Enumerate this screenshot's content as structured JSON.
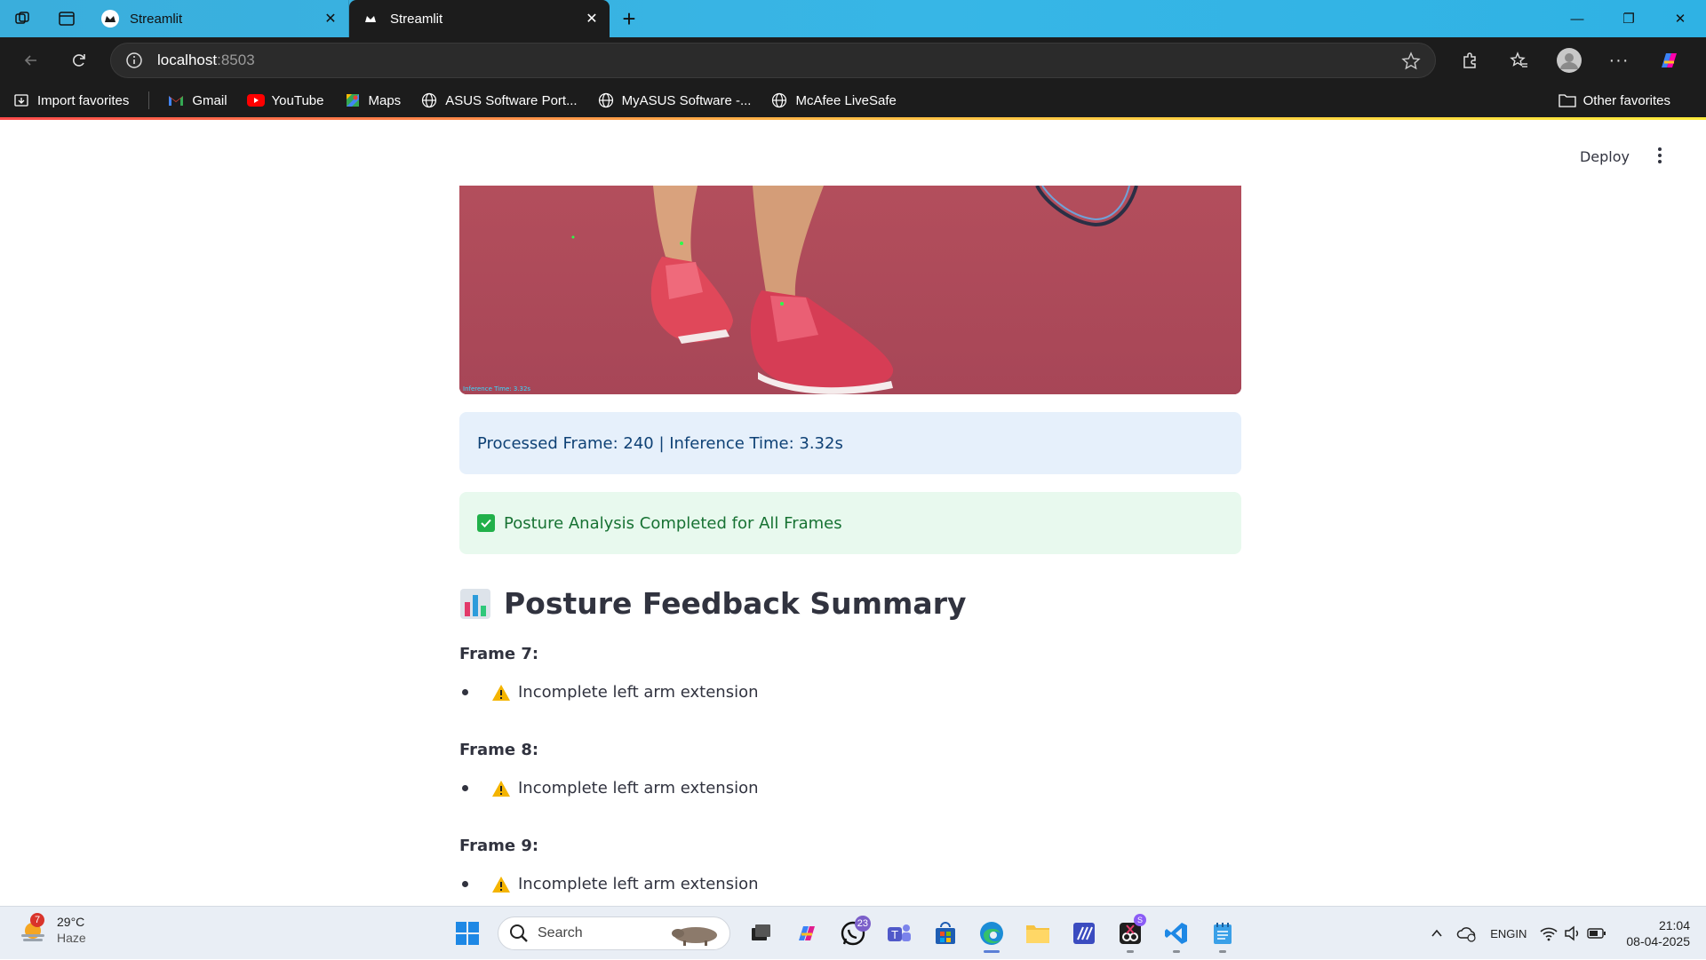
{
  "browser": {
    "tabs": [
      {
        "title": "Streamlit",
        "active": false
      },
      {
        "title": "Streamlit",
        "active": true
      }
    ],
    "address": {
      "host": "localhost",
      "port": ":8503"
    },
    "bookmarks": [
      {
        "label": "Import favorites",
        "icon": "import-icon"
      },
      {
        "label": "Gmail",
        "icon": "gmail-icon"
      },
      {
        "label": "YouTube",
        "icon": "youtube-icon"
      },
      {
        "label": "Maps",
        "icon": "maps-icon"
      },
      {
        "label": "ASUS Software Port...",
        "icon": "globe-icon"
      },
      {
        "label": "MyASUS Software -...",
        "icon": "globe-icon"
      },
      {
        "label": "McAfee LiveSafe",
        "icon": "globe-icon"
      }
    ],
    "other_favorites": "Other favorites"
  },
  "app": {
    "deploy_label": "Deploy",
    "video_caption": "Inference Time: 3.32s",
    "info_message": "Processed Frame: 240 | Inference Time: 3.32s",
    "success_message": "Posture Analysis Completed for All Frames",
    "summary_heading": "Posture Feedback Summary",
    "frames": [
      {
        "label": "Frame 7:",
        "feedback": "Incomplete left arm extension"
      },
      {
        "label": "Frame 8:",
        "feedback": "Incomplete left arm extension"
      },
      {
        "label": "Frame 9:",
        "feedback": "Incomplete left arm extension"
      }
    ]
  },
  "taskbar": {
    "weather": {
      "temp": "29°C",
      "condition": "Haze",
      "alert_count": "7"
    },
    "search_placeholder": "Search",
    "whatsapp_badge": "23",
    "lang_top": "ENG",
    "lang_bottom": "IN",
    "time": "21:04",
    "date": "08-04-2025"
  },
  "colors": {
    "info_bg": "#e6f0fb",
    "info_text": "#0e4175",
    "success_bg": "#e8f9ee",
    "success_text": "#177233",
    "browser_chrome": "#1c1c1c",
    "titlebar": "#37b6e6"
  }
}
